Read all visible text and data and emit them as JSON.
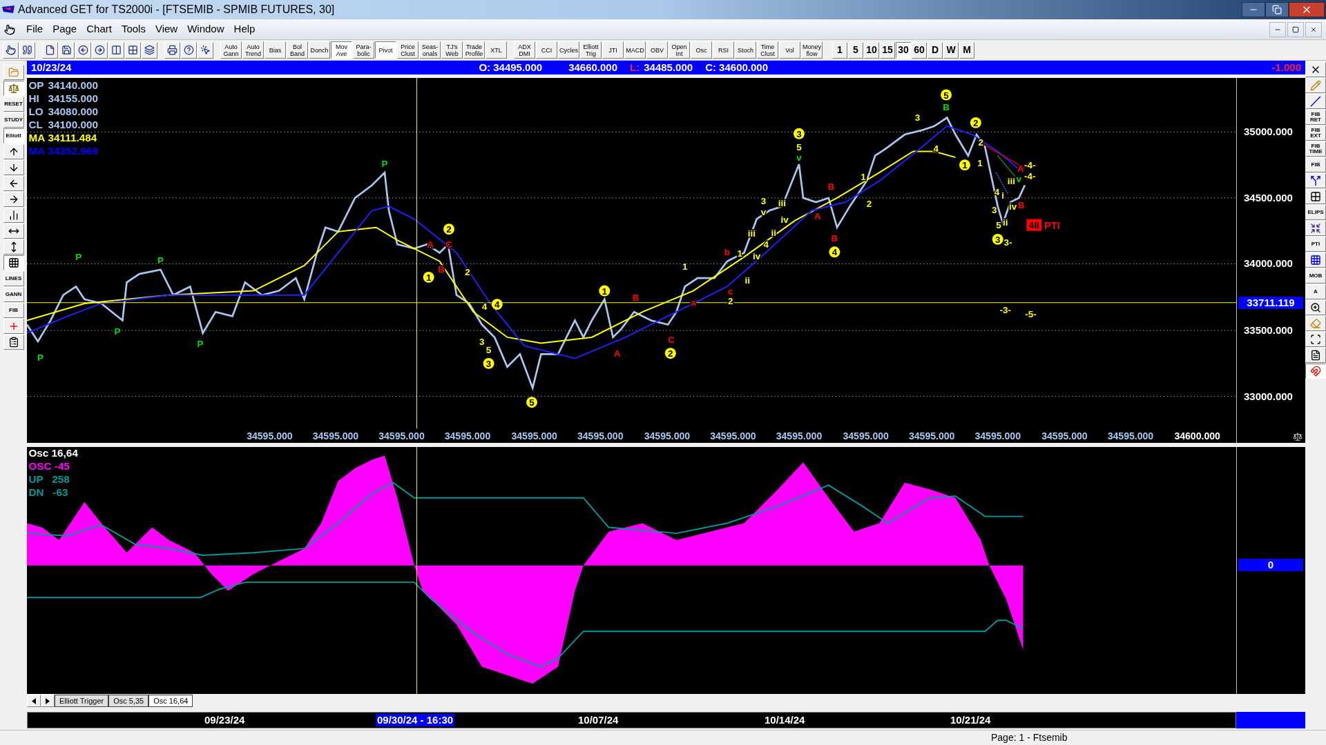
{
  "window": {
    "title": "Advanced GET for TS2000i - [FTSEMIB - SPMIB FUTURES, 30]"
  },
  "menu": [
    "File",
    "Page",
    "Chart",
    "Tools",
    "View",
    "Window",
    "Help"
  ],
  "toolbar": {
    "study_buttons": [
      {
        "label": "Auto Gann",
        "selected": false
      },
      {
        "label": "Auto Trend",
        "selected": false
      },
      {
        "label": "Bias",
        "selected": false
      },
      {
        "label": "Bol Band",
        "selected": false
      },
      {
        "label": "Donch",
        "selected": false
      },
      {
        "label": "Mov Ave",
        "selected": true
      },
      {
        "label": "Para- bolic",
        "selected": false
      },
      {
        "label": "Pivot",
        "selected": true
      },
      {
        "label": "Price Clust",
        "selected": false
      },
      {
        "label": "Seas- onals",
        "selected": false
      },
      {
        "label": "TJ's Web",
        "selected": false
      },
      {
        "label": "Trade Profile",
        "selected": false
      },
      {
        "label": "XTL",
        "selected": false
      }
    ],
    "indicator_buttons": [
      {
        "label": "ADX DMI",
        "selected": false
      },
      {
        "label": "CCI",
        "selected": false
      },
      {
        "label": "Cycles",
        "selected": false
      },
      {
        "label": "Elliott Trig",
        "selected": false
      },
      {
        "label": "JTI",
        "selected": false
      },
      {
        "label": "MACD",
        "selected": false
      },
      {
        "label": "OBV",
        "selected": false
      },
      {
        "label": "Open Int",
        "selected": false
      },
      {
        "label": "Osc",
        "selected": false
      },
      {
        "label": "RSI",
        "selected": false
      },
      {
        "label": "Stoch",
        "selected": false
      },
      {
        "label": "Time Clust",
        "selected": false
      },
      {
        "label": "Vol",
        "selected": false
      },
      {
        "label": "Money flow",
        "selected": false
      }
    ],
    "timeframes": [
      {
        "label": "1",
        "selected": false
      },
      {
        "label": "5",
        "selected": false
      },
      {
        "label": "10",
        "selected": false
      },
      {
        "label": "15",
        "selected": false
      },
      {
        "label": "30",
        "selected": true
      },
      {
        "label": "60",
        "selected": false
      },
      {
        "label": "D",
        "selected": false
      },
      {
        "label": "W",
        "selected": false
      },
      {
        "label": "M",
        "selected": false
      }
    ]
  },
  "left_tools": [
    {
      "kind": "icon",
      "selected": false
    },
    {
      "kind": "icon",
      "selected": true
    },
    {
      "kind": "labeled",
      "label": "RESET",
      "selected": false
    },
    {
      "kind": "labeled",
      "label": "STUDY",
      "selected": false
    },
    {
      "kind": "labeled",
      "label": "Elliott",
      "selected": true
    },
    {
      "kind": "icon",
      "selected": false
    },
    {
      "kind": "icon",
      "selected": false
    },
    {
      "kind": "icon",
      "selected": false
    },
    {
      "kind": "icon",
      "selected": false
    },
    {
      "kind": "icon",
      "selected": false
    },
    {
      "kind": "icon",
      "selected": false
    },
    {
      "kind": "icon",
      "selected": false
    },
    {
      "kind": "icon",
      "selected": true
    },
    {
      "kind": "labeled",
      "label": "LINES",
      "selected": false
    },
    {
      "kind": "labeled",
      "label": "GANN",
      "selected": false
    },
    {
      "kind": "labeled",
      "label": "FIB",
      "selected": false
    },
    {
      "kind": "icon",
      "selected": false
    },
    {
      "kind": "icon",
      "selected": false
    }
  ],
  "right_tools": [
    {
      "kind": "icon",
      "selected": false
    },
    {
      "kind": "icon",
      "selected": false
    },
    {
      "kind": "icon",
      "selected": false
    },
    {
      "kind": "labeled",
      "label": "FIB RET",
      "selected": false
    },
    {
      "kind": "labeled",
      "label": "FIB EXT",
      "selected": false
    },
    {
      "kind": "labeled",
      "label": "FIB TIME",
      "selected": false
    },
    {
      "kind": "labeled",
      "label": "FIB",
      "selected": false
    },
    {
      "kind": "icon",
      "selected": false
    },
    {
      "kind": "icon",
      "selected": false
    },
    {
      "kind": "labeled",
      "label": "ELIPS",
      "selected": false
    },
    {
      "kind": "icon",
      "selected": false
    },
    {
      "kind": "labeled",
      "label": "PTI",
      "selected": false
    },
    {
      "kind": "icon",
      "selected": false
    },
    {
      "kind": "labeled",
      "label": "MOB",
      "selected": false
    },
    {
      "kind": "labeled",
      "label": "A",
      "selected": false
    },
    {
      "kind": "icon",
      "selected": false
    },
    {
      "kind": "icon",
      "selected": false
    },
    {
      "kind": "icon",
      "selected": false
    },
    {
      "kind": "icon",
      "selected": false
    },
    {
      "kind": "icon",
      "selected": true
    }
  ],
  "info_bar": {
    "date": "10/23/24",
    "open": "O: 34495.000",
    "high": "34660.000",
    "low_label": "L:",
    "low": "34485.000",
    "close": "C: 34600.000",
    "change": "-1.000"
  },
  "price_panel": {
    "legend": [
      {
        "label": "OP",
        "value": "34140.000",
        "color": "#a8c8f0"
      },
      {
        "label": "HI",
        "value": "34155.000",
        "color": "#a8c8f0"
      },
      {
        "label": "LO",
        "value": "34080.000",
        "color": "#a8c8f0"
      },
      {
        "label": "CL",
        "value": "34100.000",
        "color": "#a8c8f0"
      },
      {
        "label": "MA",
        "value": "34111.484",
        "color": "#ffff00"
      },
      {
        "label": "MA",
        "value": "34352.969",
        "color": "#0000ff"
      }
    ],
    "y_labels": [
      "35000.000",
      "34500.000",
      "34000.000",
      "33500.000",
      "33000.000"
    ],
    "cursor_price": "33711.119",
    "x_labels": [
      "34595.000",
      "34595.000",
      "34595.000",
      "34595.000",
      "34595.000",
      "34595.000",
      "34595.000",
      "34595.000",
      "34595.000",
      "34595.000",
      "34595.000",
      "34595.000",
      "34595.000",
      "34595.000",
      "34600.000"
    ],
    "pti": {
      "count": "48",
      "label": "PTI"
    },
    "wave_labels": [
      {
        "text": "P",
        "color": "#00dd00",
        "kind": "plain"
      },
      {
        "text": "P",
        "color": "#00dd00",
        "kind": "plain"
      },
      {
        "text": "P",
        "color": "#00dd00",
        "kind": "plain"
      },
      {
        "text": "P",
        "color": "#00dd00",
        "kind": "plain"
      },
      {
        "text": "P",
        "color": "#00dd00",
        "kind": "plain"
      },
      {
        "text": "P",
        "color": "#00dd00",
        "kind": "plain"
      },
      {
        "text": "A",
        "color": "#ff0000",
        "kind": "plain"
      },
      {
        "text": "B",
        "color": "#ff0000",
        "kind": "plain"
      },
      {
        "text": "C",
        "color": "#ff0000",
        "kind": "plain"
      },
      {
        "text": "1",
        "color": "#ffff00",
        "kind": "circled"
      },
      {
        "text": "2",
        "color": "#ffff00",
        "kind": "circled"
      },
      {
        "text": "2",
        "color": "#ffff00",
        "kind": "plain"
      },
      {
        "text": "4",
        "color": "#ffff00",
        "kind": "plain"
      },
      {
        "text": "4",
        "color": "#ffff00",
        "kind": "circled"
      },
      {
        "text": "3",
        "color": "#ffff00",
        "kind": "plain"
      },
      {
        "text": "5",
        "color": "#ffff00",
        "kind": "plain"
      },
      {
        "text": "3",
        "color": "#ffff00",
        "kind": "circled"
      },
      {
        "text": "5",
        "color": "#ffff00",
        "kind": "circled"
      },
      {
        "text": "1",
        "color": "#ffff00",
        "kind": "circled"
      },
      {
        "text": "A",
        "color": "#ff0000",
        "kind": "plain"
      },
      {
        "text": "B",
        "color": "#ff0000",
        "kind": "plain"
      },
      {
        "text": "C",
        "color": "#ff0000",
        "kind": "plain"
      },
      {
        "text": "2",
        "color": "#ffff00",
        "kind": "circled"
      },
      {
        "text": "1",
        "color": "#ffff00",
        "kind": "plain"
      },
      {
        "text": "a",
        "color": "#ff0000",
        "kind": "plain"
      },
      {
        "text": "b",
        "color": "#ff0000",
        "kind": "plain"
      },
      {
        "text": "c",
        "color": "#ff0000",
        "kind": "plain"
      },
      {
        "text": "2",
        "color": "#ffff00",
        "kind": "plain"
      },
      {
        "text": "1",
        "color": "#ffff00",
        "kind": "plain"
      },
      {
        "text": "iii",
        "color": "#ffff00",
        "kind": "plain"
      },
      {
        "text": "iv",
        "color": "#ffff00",
        "kind": "plain"
      },
      {
        "text": "ii",
        "color": "#ffff00",
        "kind": "plain"
      },
      {
        "text": "3",
        "color": "#ffff00",
        "kind": "plain"
      },
      {
        "text": "v",
        "color": "#ffff00",
        "kind": "plain"
      },
      {
        "text": "4",
        "color": "#ffff00",
        "kind": "plain"
      },
      {
        "text": "ii",
        "color": "#ffff00",
        "kind": "plain"
      },
      {
        "text": "iii",
        "color": "#ffff00",
        "kind": "plain"
      },
      {
        "text": "iv",
        "color": "#ffff00",
        "kind": "plain"
      },
      {
        "text": "3",
        "color": "#ffff00",
        "kind": "circled"
      },
      {
        "text": "5",
        "color": "#ffff00",
        "kind": "plain"
      },
      {
        "text": "v",
        "color": "#00dd00",
        "kind": "plain"
      },
      {
        "text": "A",
        "color": "#ff0000",
        "kind": "plain"
      },
      {
        "text": "B",
        "color": "#ff0000",
        "kind": "plain"
      },
      {
        "text": "B",
        "color": "#ff0000",
        "kind": "plain"
      },
      {
        "text": "4",
        "color": "#ffff00",
        "kind": "circled"
      },
      {
        "text": "1",
        "color": "#ffff00",
        "kind": "plain"
      },
      {
        "text": "2",
        "color": "#ffff00",
        "kind": "plain"
      },
      {
        "text": "3",
        "color": "#ffff00",
        "kind": "plain"
      },
      {
        "text": "5",
        "color": "#ffff00",
        "kind": "circled"
      },
      {
        "text": "B",
        "color": "#00dd00",
        "kind": "plain"
      },
      {
        "text": "4",
        "color": "#ffff00",
        "kind": "plain"
      },
      {
        "text": "1",
        "color": "#ffff00",
        "kind": "circled"
      },
      {
        "text": "2",
        "color": "#ffff00",
        "kind": "circled"
      },
      {
        "text": "2",
        "color": "#ffff00",
        "kind": "plain"
      },
      {
        "text": "1",
        "color": "#ffff00",
        "kind": "plain"
      },
      {
        "text": "A",
        "color": "#ff0000",
        "kind": "plain"
      },
      {
        "text": "-4-",
        "color": "#ffff00",
        "kind": "plain"
      },
      {
        "text": "-4-",
        "color": "#ffff00",
        "kind": "plain"
      },
      {
        "text": "iii",
        "color": "#ffff00",
        "kind": "plain"
      },
      {
        "text": "v",
        "color": "#00dd00",
        "kind": "plain"
      },
      {
        "text": "4",
        "color": "#ffff00",
        "kind": "plain"
      },
      {
        "text": "i",
        "color": "#ffff00",
        "kind": "plain"
      },
      {
        "text": "3",
        "color": "#ffff00",
        "kind": "plain"
      },
      {
        "text": "iv",
        "color": "#ffff00",
        "kind": "plain"
      },
      {
        "text": "B",
        "color": "#ff0000",
        "kind": "plain"
      },
      {
        "text": "5",
        "color": "#ffff00",
        "kind": "plain"
      },
      {
        "text": "ii",
        "color": "#ffff00",
        "kind": "plain"
      },
      {
        "text": "3",
        "color": "#ffff00",
        "kind": "circled"
      },
      {
        "text": "3-",
        "color": "#ffff00",
        "kind": "plain"
      },
      {
        "text": "-3-",
        "color": "#ffff00",
        "kind": "plain"
      },
      {
        "text": "-5-",
        "color": "#ffff00",
        "kind": "plain"
      }
    ]
  },
  "oscillator_panel": {
    "legend": [
      {
        "text": "Osc 16,64",
        "color": "#ffffff"
      },
      {
        "text": "OSC -45",
        "color": "#ff00ff"
      },
      {
        "text": "UP   258",
        "color": "#009999"
      },
      {
        "text": "DN   -63",
        "color": "#009999"
      }
    ],
    "zero_label": "0"
  },
  "chart_tabs": [
    {
      "label": "Elliott Trigger",
      "selected": false
    },
    {
      "label": "Osc 5,35",
      "selected": false
    },
    {
      "label": "Osc 16,64",
      "selected": true
    }
  ],
  "date_axis": [
    {
      "label": "09/23/24",
      "selected": false
    },
    {
      "label": "09/30/24 - 16:30",
      "selected": true
    },
    {
      "label": "10/07/24",
      "selected": false
    },
    {
      "label": "10/14/24",
      "selected": false
    },
    {
      "label": "10/21/24",
      "selected": false
    }
  ],
  "status_bar": {
    "page": "Page: 1 - Ftsemib"
  }
}
